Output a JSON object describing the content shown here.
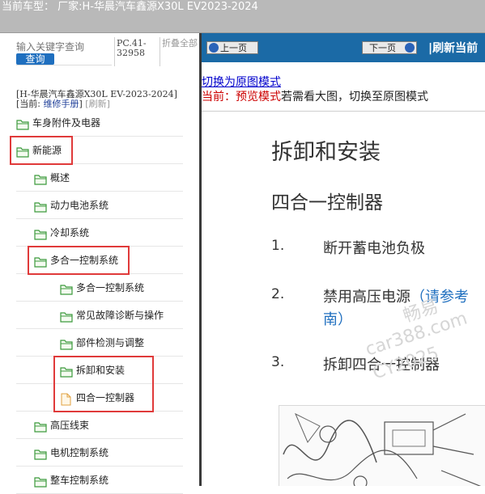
{
  "header": {
    "title": "当前车型：  厂家:H-华晨汽车鑫源X30L EV2023-2024"
  },
  "left_panel": {
    "search_placeholder": "输入关键字查询",
    "search_button": "查询",
    "pc_code": "PC.41-32958",
    "collapse_all": "折叠全部",
    "car_path": "[H-华晨汽车鑫源X30L EV-2023-2024]",
    "current_prefix": "[当前: ",
    "current_value": "维修手册",
    "current_suffix": "]",
    "refresh_link": "[刷新]",
    "tree": [
      {
        "label": "车身附件及电器",
        "type": "folder",
        "level": 0
      },
      {
        "label": "新能源",
        "type": "folder",
        "level": 0,
        "highlighted": true
      },
      {
        "label": "概述",
        "type": "folder",
        "level": 1
      },
      {
        "label": "动力电池系统",
        "type": "folder",
        "level": 1
      },
      {
        "label": "冷却系统",
        "type": "folder",
        "level": 1
      },
      {
        "label": "多合一控制系统",
        "type": "folder",
        "level": 1,
        "highlighted": true
      },
      {
        "label": "多合一控制系统",
        "type": "folder",
        "level": 2
      },
      {
        "label": "常见故障诊断与操作",
        "type": "folder",
        "level": 2
      },
      {
        "label": "部件检测与调整",
        "type": "folder",
        "level": 2
      },
      {
        "label": "拆卸和安装",
        "type": "folder",
        "level": 2,
        "highlighted": true
      },
      {
        "label": "四合一控制器",
        "type": "file",
        "level": 2,
        "highlighted": true
      },
      {
        "label": "高压线束",
        "type": "folder",
        "level": 1
      },
      {
        "label": "电机控制系统",
        "type": "folder",
        "level": 1
      },
      {
        "label": "整车控制系统",
        "type": "folder",
        "level": 1
      }
    ]
  },
  "right_panel": {
    "prev_button": "上一页",
    "next_button": "下一页",
    "refresh_current": "|刷新当前",
    "switch_link": "切换为原图模式",
    "mode_prefix": "当前：预览模式",
    "mode_suffix": "若需看大图，切换至原图模式",
    "doc_title": "拆卸和安装",
    "doc_subtitle": "四合一控制器",
    "steps": [
      {
        "num": "1.",
        "text": "断开蓄电池负极"
      },
      {
        "num": "2.",
        "text": "禁用高压电源",
        "link": "（请参考",
        "line2": "南）"
      },
      {
        "num": "3.",
        "text": "拆卸四合一控制器"
      }
    ],
    "watermark_lines": [
      "畅易",
      "car388.com",
      "CY2025"
    ]
  },
  "colors": {
    "nav_blue": "#1b6aa6",
    "highlight_red": "#e03a3a",
    "folder_green": "#3c9a3c",
    "link_blue": "#0000cc",
    "mode_red": "#cc0000"
  }
}
